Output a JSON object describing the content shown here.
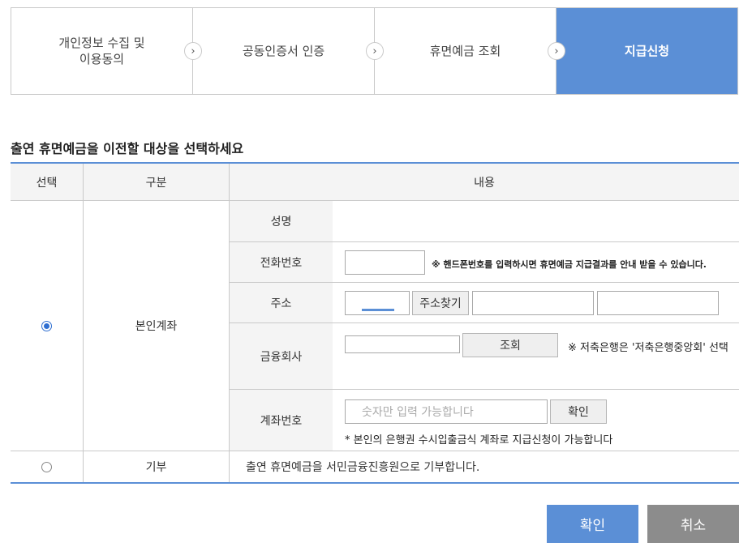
{
  "steps": [
    {
      "label": "개인정보 수집 및\n이용동의"
    },
    {
      "label": "공동인증서 인증"
    },
    {
      "label": "휴면예금 조회"
    },
    {
      "label": "지급신청"
    }
  ],
  "arrow_glyph": "›",
  "section_title": "출연 휴면예금을 이전할 대상을 선택하세요",
  "table": {
    "headers": {
      "select": "선택",
      "category": "구분",
      "content": "내용"
    },
    "own_account": {
      "category": "본인계좌",
      "selected": true,
      "fields": {
        "name_label": "성명",
        "phone_label": "전화번호",
        "phone_note": "※ 핸드폰번호를 입력하시면 휴면예금 지급결과를 안내 받을 수 있습니다.",
        "address_label": "주소",
        "address_search_button": "주소찾기",
        "bank_label": "금융회사",
        "bank_lookup_button": "조회",
        "bank_note": "※ 저축은행은 '저축은행중앙회' 선택",
        "account_label": "계좌번호",
        "account_placeholder": "숫자만 입력 가능합니다",
        "account_confirm_button": "확인",
        "account_note": "* 본인의 은행권 수시입출금식 계좌로 지급신청이 가능합니다"
      }
    },
    "donate": {
      "category": "기부",
      "selected": false,
      "content": "출연 휴면예금을 서민금융진흥원으로 기부합니다."
    }
  },
  "buttons": {
    "confirm": "확인",
    "cancel": "취소"
  },
  "colors": {
    "accent": "#5b8fd6",
    "cancel": "#8c8c8c",
    "radio": "#2f6fd1"
  }
}
